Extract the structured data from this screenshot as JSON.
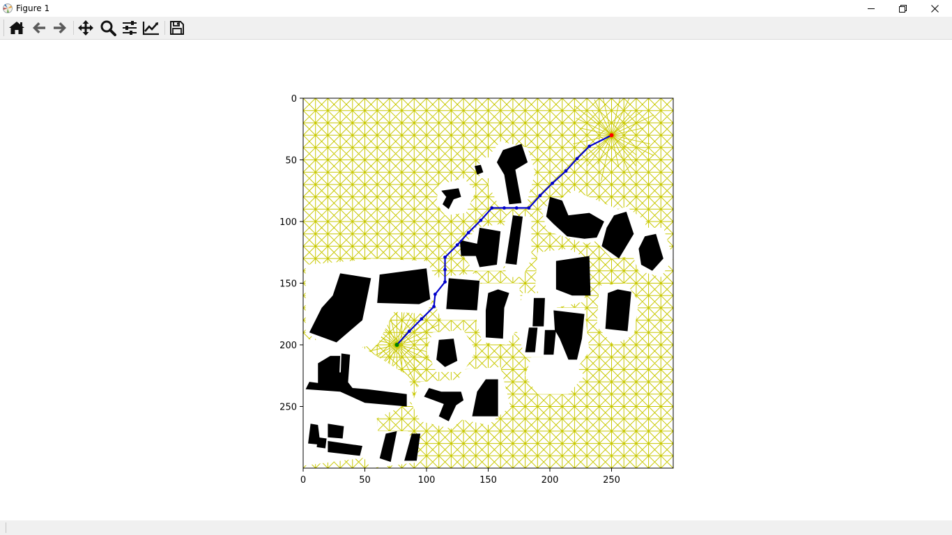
{
  "window": {
    "title": "Figure 1",
    "icon": "matplotlib-logo-icon",
    "controls": [
      "minimize-icon",
      "restore-icon",
      "close-icon"
    ]
  },
  "toolbar": {
    "buttons": [
      {
        "name": "home-button",
        "icon": "home-icon"
      },
      {
        "name": "back-button",
        "icon": "arrow-left-icon"
      },
      {
        "name": "forward-button",
        "icon": "arrow-right-icon"
      },
      {
        "name": "pan-button",
        "icon": "move-arrows-icon"
      },
      {
        "name": "zoom-button",
        "icon": "magnifier-icon"
      },
      {
        "name": "subplots-button",
        "icon": "sliders-icon"
      },
      {
        "name": "edit-axes-button",
        "icon": "line-chart-icon"
      },
      {
        "name": "save-button",
        "icon": "floppy-disk-icon"
      }
    ]
  },
  "status": {
    "text": ""
  },
  "chart_data": {
    "type": "scatter",
    "title": "",
    "xlabel": "",
    "ylabel": "",
    "xlim": [
      0,
      300
    ],
    "ylim": [
      300,
      0
    ],
    "y_inverted": true,
    "xticks": [
      "0",
      "50",
      "100",
      "150",
      "200",
      "250"
    ],
    "yticks": [
      "0",
      "50",
      "100",
      "150",
      "200",
      "250"
    ],
    "grid": false,
    "roadmap_color": "#c8c800",
    "obstacle_color": "#000000",
    "path_color": "#0000cc",
    "path": {
      "x": [
        250,
        232,
        222,
        213,
        202,
        192,
        183,
        173,
        163,
        153,
        144,
        134,
        125,
        115,
        115,
        115,
        107,
        106,
        96,
        86,
        76
      ],
      "y": [
        30,
        39,
        49,
        59,
        69,
        79,
        89,
        89,
        89,
        89,
        99,
        109,
        119,
        129,
        139,
        149,
        159,
        169,
        179,
        189,
        200
      ]
    },
    "start": {
      "x": 76,
      "y": 200,
      "color": "#008000"
    },
    "goal": {
      "x": 250,
      "y": 30,
      "color": "#ff0000"
    }
  }
}
